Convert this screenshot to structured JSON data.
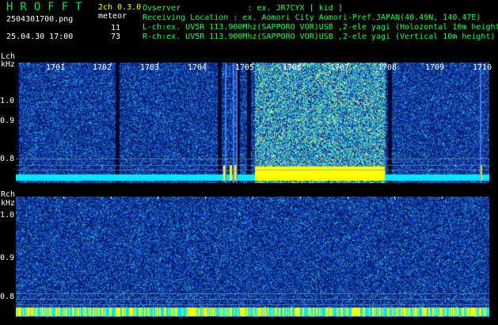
{
  "header": {
    "logo": "HROFFT",
    "filename": "2504301700.png",
    "datetime": "25.04.30 17:00",
    "version": "2ch 0.3.0",
    "meteor_label": "meteor",
    "meteor_l": "11",
    "meteor_r": "73",
    "observer": "Ovserver              : ex. JR7CYX [ kid ]",
    "location": "Receiving Location : ex. Aomori City Aomori-Pref.JAPAN(40.49N, 140.47E)",
    "lch_info": "L-ch:ex. UV5R 113.900Mhz(SAPPORO VOR)USB ,2-ele yagi (Holozontal 10m height)",
    "rch_info": "R-ch:ex. UV5R 113.900Mhz(SAPPORO VOR)USB ,2-ele yagi (Vertical 10m height)"
  },
  "axes": {
    "lch_label": "Lch",
    "unit": "kHz",
    "rch_label": "Rch",
    "y_ticks": [
      "1.0",
      "0.9",
      "0.8"
    ],
    "minutes": [
      "1701",
      "1702",
      "1703",
      "1704",
      "1705",
      "1706",
      "1707",
      "1708",
      "1709",
      "1710"
    ]
  },
  "colors": {
    "background": "#000000",
    "noise_dark": "#001a6e",
    "noise_mid": "#1e5cd6",
    "noise_bright": "#27d4c8",
    "carrier": "#ffff00",
    "band_cyan": "#00e5ff",
    "logo": "#00e060",
    "meta_text": "#19ff4a",
    "label_text": "#ffff00"
  }
}
